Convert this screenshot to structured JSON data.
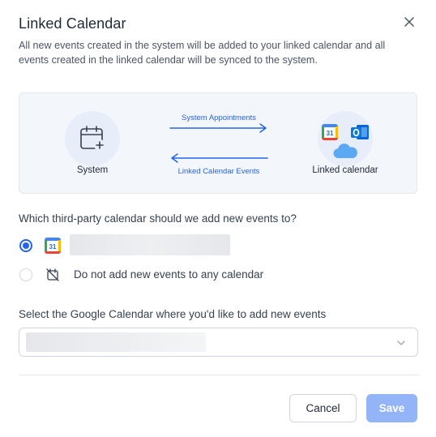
{
  "dialog": {
    "title": "Linked Calendar",
    "description": "All new events created in the system will be added to your linked calendar and all events created in the linked calendar will be synced to the system."
  },
  "diagram": {
    "system_label": "System",
    "linked_label": "Linked calendar",
    "top_arrow_label": "System Appointments",
    "bottom_arrow_label": "Linked Calendar Events",
    "gcal_badge": "31"
  },
  "question": "Which third-party calendar should we add new events to?",
  "options": {
    "google": {
      "selected": true,
      "icon": "google-calendar-icon",
      "badge": "31"
    },
    "none": {
      "selected": false,
      "icon": "calendar-off-icon",
      "label": "Do not add new events to any calendar"
    }
  },
  "calendar_select": {
    "label": "Select the Google Calendar where you'd like to add new events"
  },
  "footer": {
    "cancel_label": "Cancel",
    "save_label": "Save"
  },
  "colors": {
    "accent": "#2563eb",
    "save_disabled": "#93b4f6",
    "diagram_bg": "#f3f6fb"
  }
}
